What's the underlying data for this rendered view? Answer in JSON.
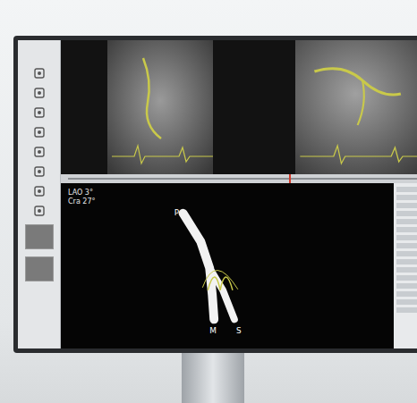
{
  "reconstruction": {
    "projection": [
      "LAO 3°",
      "Cra 27°"
    ],
    "markers": [
      "P",
      "M",
      "S"
    ]
  },
  "timeline": {
    "level": 0.62
  }
}
